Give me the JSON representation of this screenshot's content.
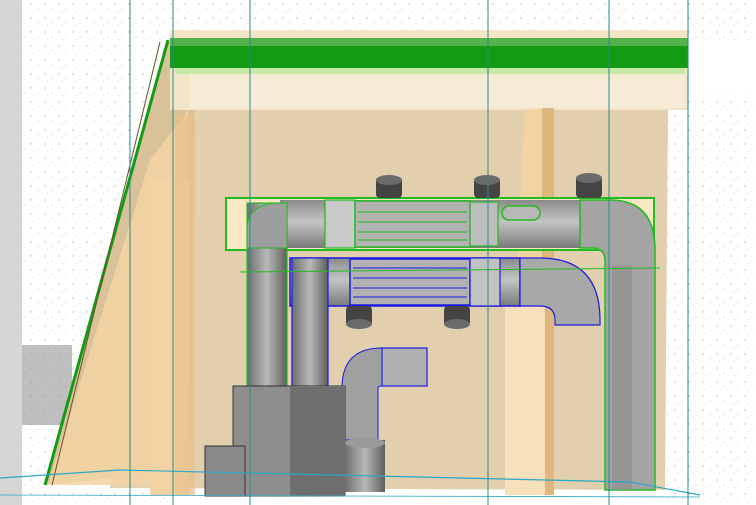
{
  "viewport": {
    "background": "#ffffff",
    "wall_color": "#e2cfae",
    "panel_color": "#fbe6c4",
    "pillar_color": "#f3d3a3",
    "duct_color": "#a8a8a8",
    "duct_dark": "#7c7c7c",
    "selected_edge": "#22bb22",
    "highlight_edge": "#1a1ae6",
    "gridline_color": "#2a8a8a",
    "slab_green": "#139b13"
  },
  "icons": {
    "pipe_end": "cylinder-icon"
  }
}
